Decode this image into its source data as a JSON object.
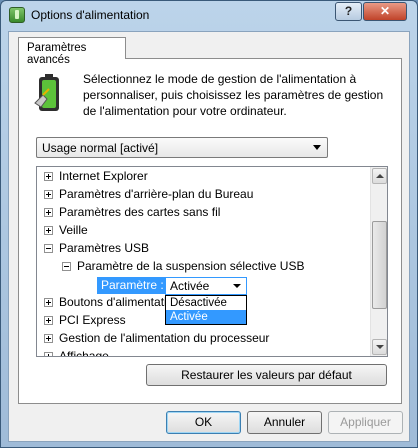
{
  "window": {
    "title": "Options d'alimentation",
    "help_glyph": "?",
    "close_glyph": "✕"
  },
  "tab": {
    "label": "Paramètres avancés"
  },
  "description": "Sélectionnez le mode de gestion de l'alimentation à personnaliser, puis choisissez les paramètres de gestion de l'alimentation pour votre ordinateur.",
  "plan_select": {
    "value": "Usage normal [activé]"
  },
  "tree": {
    "items": [
      {
        "label": "Internet Explorer",
        "expander": "+"
      },
      {
        "label": "Paramètres d'arrière-plan du Bureau",
        "expander": "+"
      },
      {
        "label": "Paramètres des cartes sans fil",
        "expander": "+"
      },
      {
        "label": "Veille",
        "expander": "+"
      },
      {
        "label": "Paramètres USB",
        "expander": "-"
      },
      {
        "label": "Paramètre de la suspension sélective USB",
        "expander": "-"
      },
      {
        "label": "Boutons d'alimentation",
        "expander": "+"
      },
      {
        "label": "PCI Express",
        "expander": "+"
      },
      {
        "label": "Gestion de l'alimentation du processeur",
        "expander": "+"
      },
      {
        "label": "Affichage",
        "expander": "+"
      }
    ],
    "setting": {
      "label": "Paramètre :",
      "value": "Activée",
      "options": [
        "Désactivée",
        "Activée"
      ],
      "selected_option": "Activée"
    }
  },
  "restore_button": "Restaurer les valeurs par défaut",
  "buttons": {
    "ok": "OK",
    "cancel": "Annuler",
    "apply": "Appliquer"
  },
  "colors": {
    "selection": "#3399ff",
    "title_gradient_top": "#bcd4ea",
    "close_button": "#c0432a"
  }
}
